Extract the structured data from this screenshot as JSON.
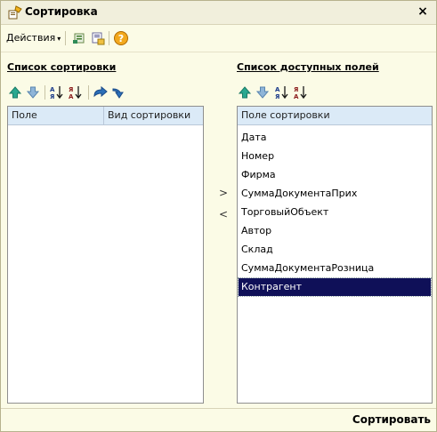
{
  "window": {
    "title": "Сортировка",
    "close_label": "×"
  },
  "toolbar": {
    "actions_label": "Действия",
    "actions_caret": "▾",
    "icons": [
      "list-icon",
      "mail-icon",
      "help-icon"
    ]
  },
  "sort_list": {
    "title": "Список сортировки",
    "columns": [
      "Поле",
      "Вид сортировки"
    ],
    "rows": []
  },
  "available_fields": {
    "title": "Список доступных полей",
    "column": "Поле сортировки",
    "items": [
      "Дата",
      "Номер",
      "Фирма",
      "СуммаДокументаПрих",
      "ТорговыйОбъект",
      "Автор",
      "Склад",
      "СуммаДокументаРозница",
      "Контрагент"
    ],
    "selected": "Контрагент"
  },
  "transfer": {
    "add_label": ">",
    "remove_label": "<"
  },
  "footer": {
    "sort_button": "Сортировать"
  },
  "colors": {
    "window_bg": "#fbfbe6",
    "header_bg": "#dbeaf7",
    "selection_bg": "#0f1058",
    "arrow_green": "#1fa18a",
    "arrow_blue": "#2b6fb8"
  }
}
